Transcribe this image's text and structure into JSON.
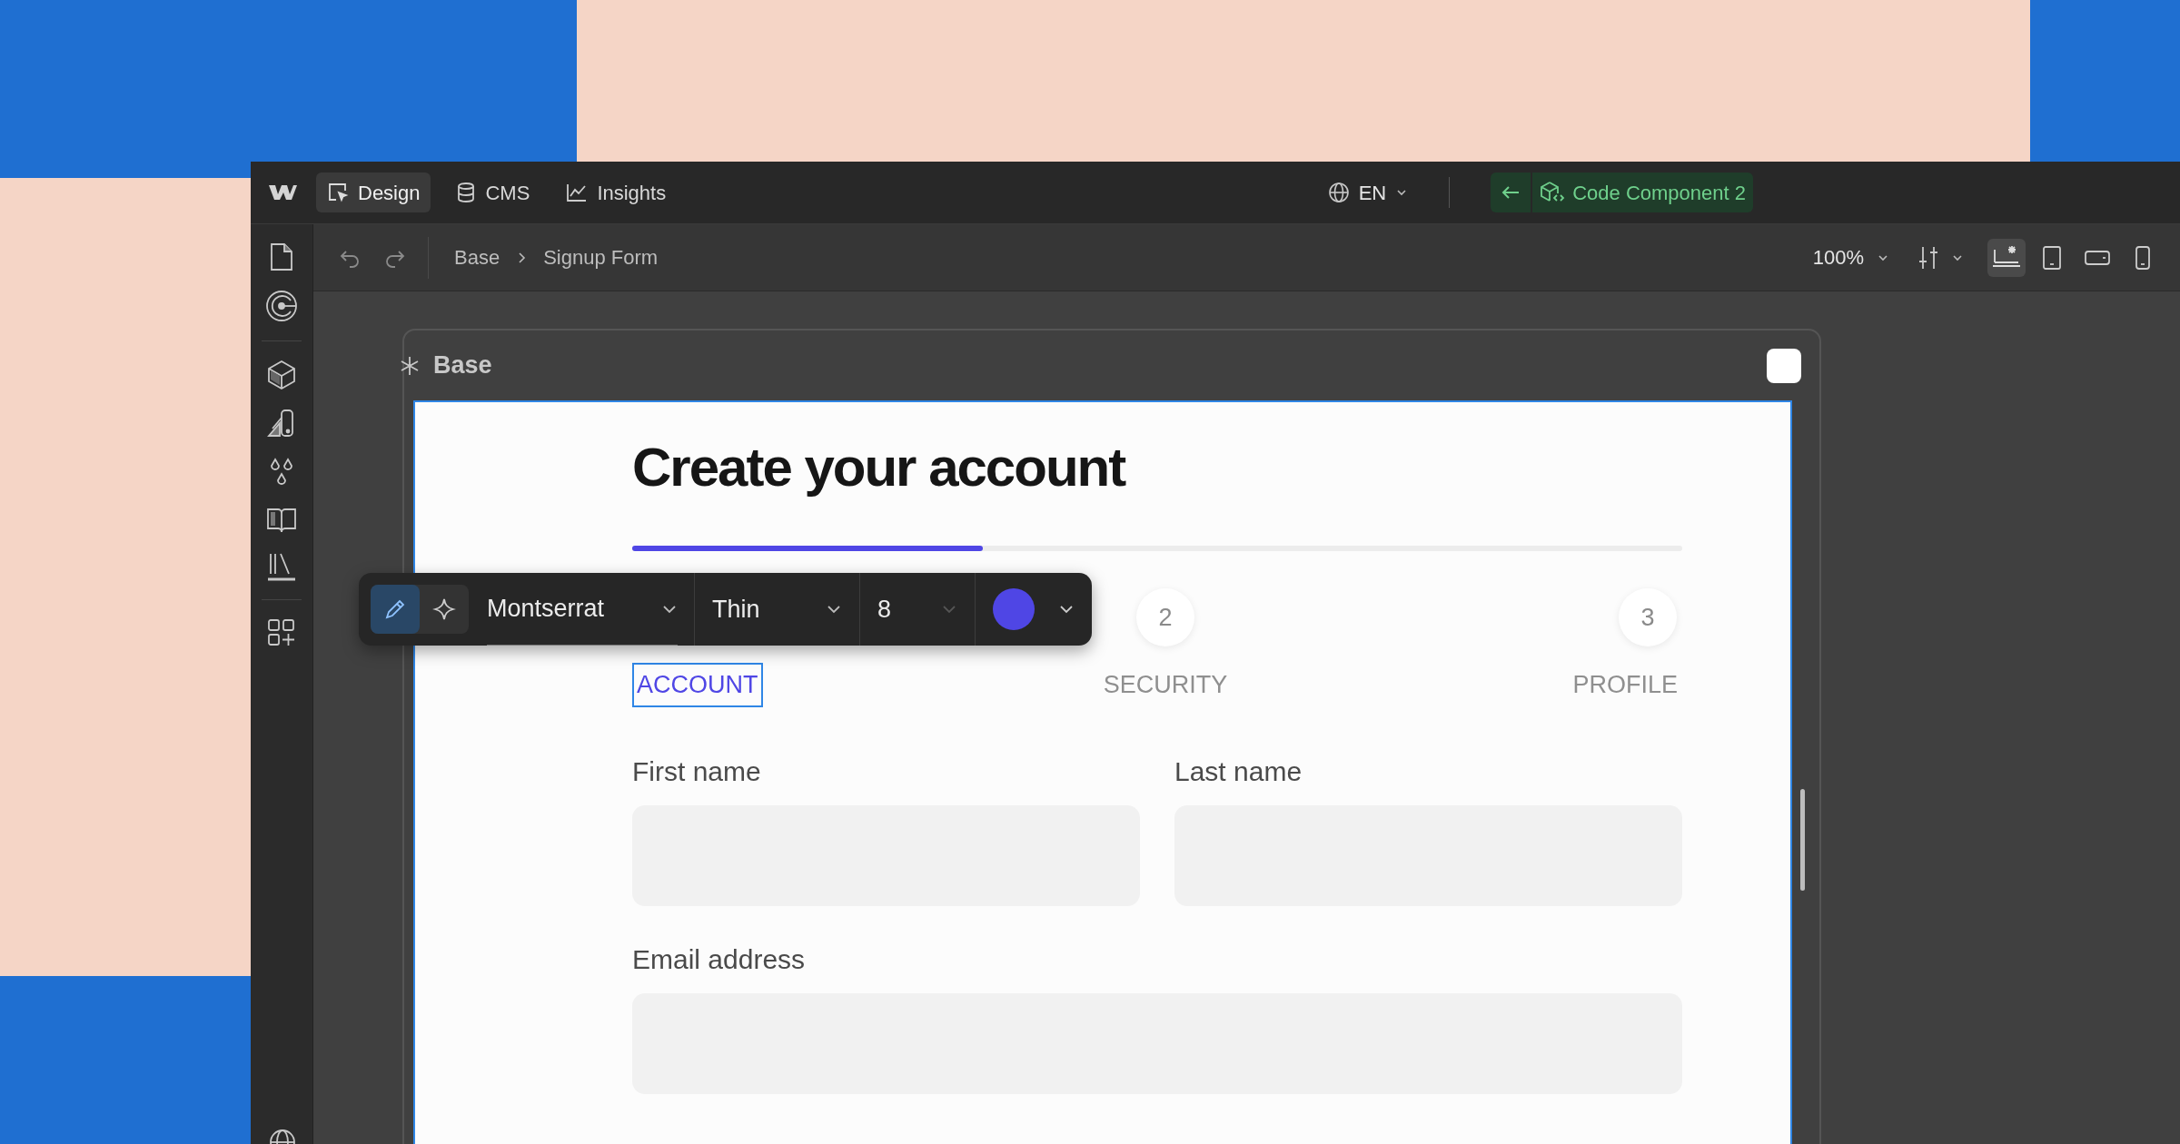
{
  "top_bar": {
    "tabs": [
      {
        "label": "Design",
        "selected": true
      },
      {
        "label": "CMS",
        "selected": false
      },
      {
        "label": "Insights",
        "selected": false
      }
    ],
    "locale": "EN",
    "component_button": "Code Component 2"
  },
  "toolbar": {
    "breadcrumbs": [
      "Base",
      "Signup Form"
    ],
    "zoom": "100%",
    "breakpoints": [
      {
        "kind": "desktop",
        "selected": true
      },
      {
        "kind": "tablet",
        "selected": false
      },
      {
        "kind": "landscape",
        "selected": false
      },
      {
        "kind": "phone",
        "selected": false
      }
    ]
  },
  "frame": {
    "label": "Base"
  },
  "form": {
    "heading": "Create your account",
    "progress": {
      "level": 0.334
    },
    "steps": [
      {
        "label": "ACCOUNT",
        "selected": true
      },
      {
        "number": "2",
        "label": "SECURITY",
        "selected": false
      },
      {
        "number": "3",
        "label": "PROFILE",
        "selected": false
      }
    ],
    "fields": [
      {
        "label": "First name"
      },
      {
        "label": "Last name"
      },
      {
        "label": "Email address"
      }
    ]
  },
  "text_toolbar": {
    "modes": [
      {
        "kind": "edit",
        "selected": true
      },
      {
        "kind": "ai",
        "selected": false
      }
    ],
    "font": "Montserrat",
    "weight": "Thin",
    "size": "8",
    "color": "#4f46e5"
  }
}
